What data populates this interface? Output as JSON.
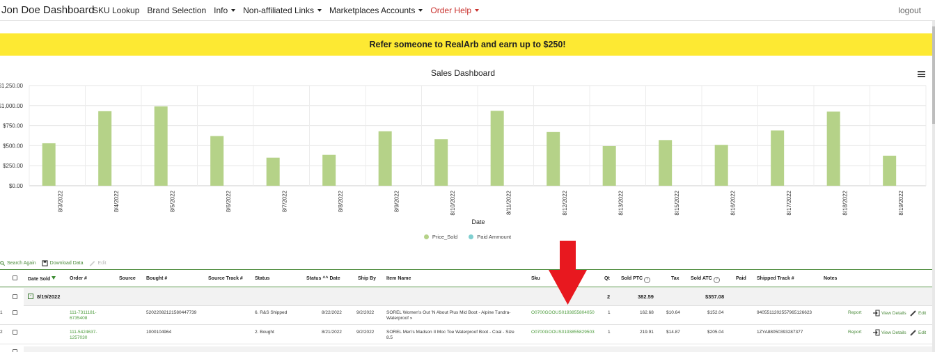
{
  "nav": {
    "brand": "Jon Doe Dashboard",
    "items": [
      {
        "label": "SKU Lookup",
        "dropdown": false
      },
      {
        "label": "Brand Selection",
        "dropdown": false
      },
      {
        "label": "Info",
        "dropdown": true
      },
      {
        "label": "Non-affiliated Links",
        "dropdown": true
      },
      {
        "label": "Marketplaces Accounts",
        "dropdown": true
      },
      {
        "label": "Order Help",
        "dropdown": true,
        "color": "#c9302c"
      }
    ],
    "logout": "logout"
  },
  "banner": {
    "text": "Refer someone to RealArb and earn up to $250!",
    "color": "#fde933"
  },
  "chart_data": {
    "type": "bar",
    "title": "Sales Dashboard",
    "xlabel": "Date",
    "ylabel": "",
    "categories": [
      "8/3/2022",
      "8/4/2022",
      "8/5/2022",
      "8/6/2022",
      "8/7/2022",
      "8/8/2022",
      "8/9/2022",
      "8/10/2022",
      "8/11/2022",
      "8/12/2022",
      "8/13/2022",
      "8/15/2022",
      "8/16/2022",
      "8/17/2022",
      "8/18/2022",
      "8/19/2022"
    ],
    "series": [
      {
        "name": "Price_Sold",
        "color": "#b5d288",
        "values": [
          530,
          930,
          990,
          620,
          350,
          385,
          680,
          580,
          935,
          670,
          495,
          570,
          510,
          690,
          925,
          375
        ]
      },
      {
        "name": "Paid Ammount",
        "color": "#7fcfd0",
        "values": []
      }
    ],
    "ylim": [
      0,
      1250
    ],
    "yticks": [
      "$0.00",
      "$250.00",
      "$500.00",
      "$750.00",
      "$1,000.00",
      "$1,250.00"
    ],
    "grid": true,
    "legend_position": "bottom"
  },
  "toolbar": {
    "search_again": "Search Again",
    "download": "Download Data",
    "edit": "Edit"
  },
  "table": {
    "headers": {
      "date_sold": "Date Sold",
      "order": "Order #",
      "source": "Source",
      "bought": "Bought #",
      "source_track": "Source Track #",
      "status": "Status",
      "status_date": "Status ^^ Date",
      "ship_by": "Ship By",
      "item_name": "Item Name",
      "sku": "Sku",
      "qt": "Qt",
      "sold_ptc": "Sold PTC",
      "tax": "Tax",
      "sold_atc": "Sold ATC",
      "paid": "Paid",
      "shipped_track": "Shipped Track #",
      "notes": "Notes"
    },
    "group": {
      "date": "8/19/2022",
      "qt": "2",
      "sold_ptc": "382.59",
      "sold_atc": "$357.08"
    },
    "rows": [
      {
        "index": "1",
        "order_line1": "111-7311181-",
        "order_line2": "6735408",
        "bought": "520220821215804477 39",
        "bought_display": "52022082121580447739",
        "status": "6. R&S Shipped",
        "status_date": "8/22/2022",
        "ship_by": "9/2/2022",
        "item_line1": "SOREL Women's Out 'N About Plus Mid Boot - Alpine Tundra-",
        "item_line2": "Waterproof »",
        "sku": "O0700GOOUS0193855804050",
        "qt": "1",
        "sold_ptc": "162.68",
        "tax": "$10.64",
        "sold_atc": "$152.04",
        "shipped_track": "9405511202557965126623",
        "report": "Report",
        "view": "View Details",
        "edit": "Edit"
      },
      {
        "index": "2",
        "order_line1": "111-5424637-",
        "order_line2": "1257030",
        "bought_display": "1000104964",
        "status": "2. Bought",
        "status_date": "8/21/2022",
        "ship_by": "9/2/2022",
        "item_line1": "SOREL Men's Madson II Moc Toe Waterproof Boot - Coal - Size",
        "item_line2": "8.5",
        "sku": "O0700GOOUS0193855829503",
        "qt": "1",
        "sold_ptc": "219.91",
        "tax": "$14.87",
        "sold_atc": "$205.04",
        "shipped_track": "1ZYA88050393287377",
        "report": "Report",
        "view": "View Details",
        "edit": "Edit"
      }
    ]
  }
}
